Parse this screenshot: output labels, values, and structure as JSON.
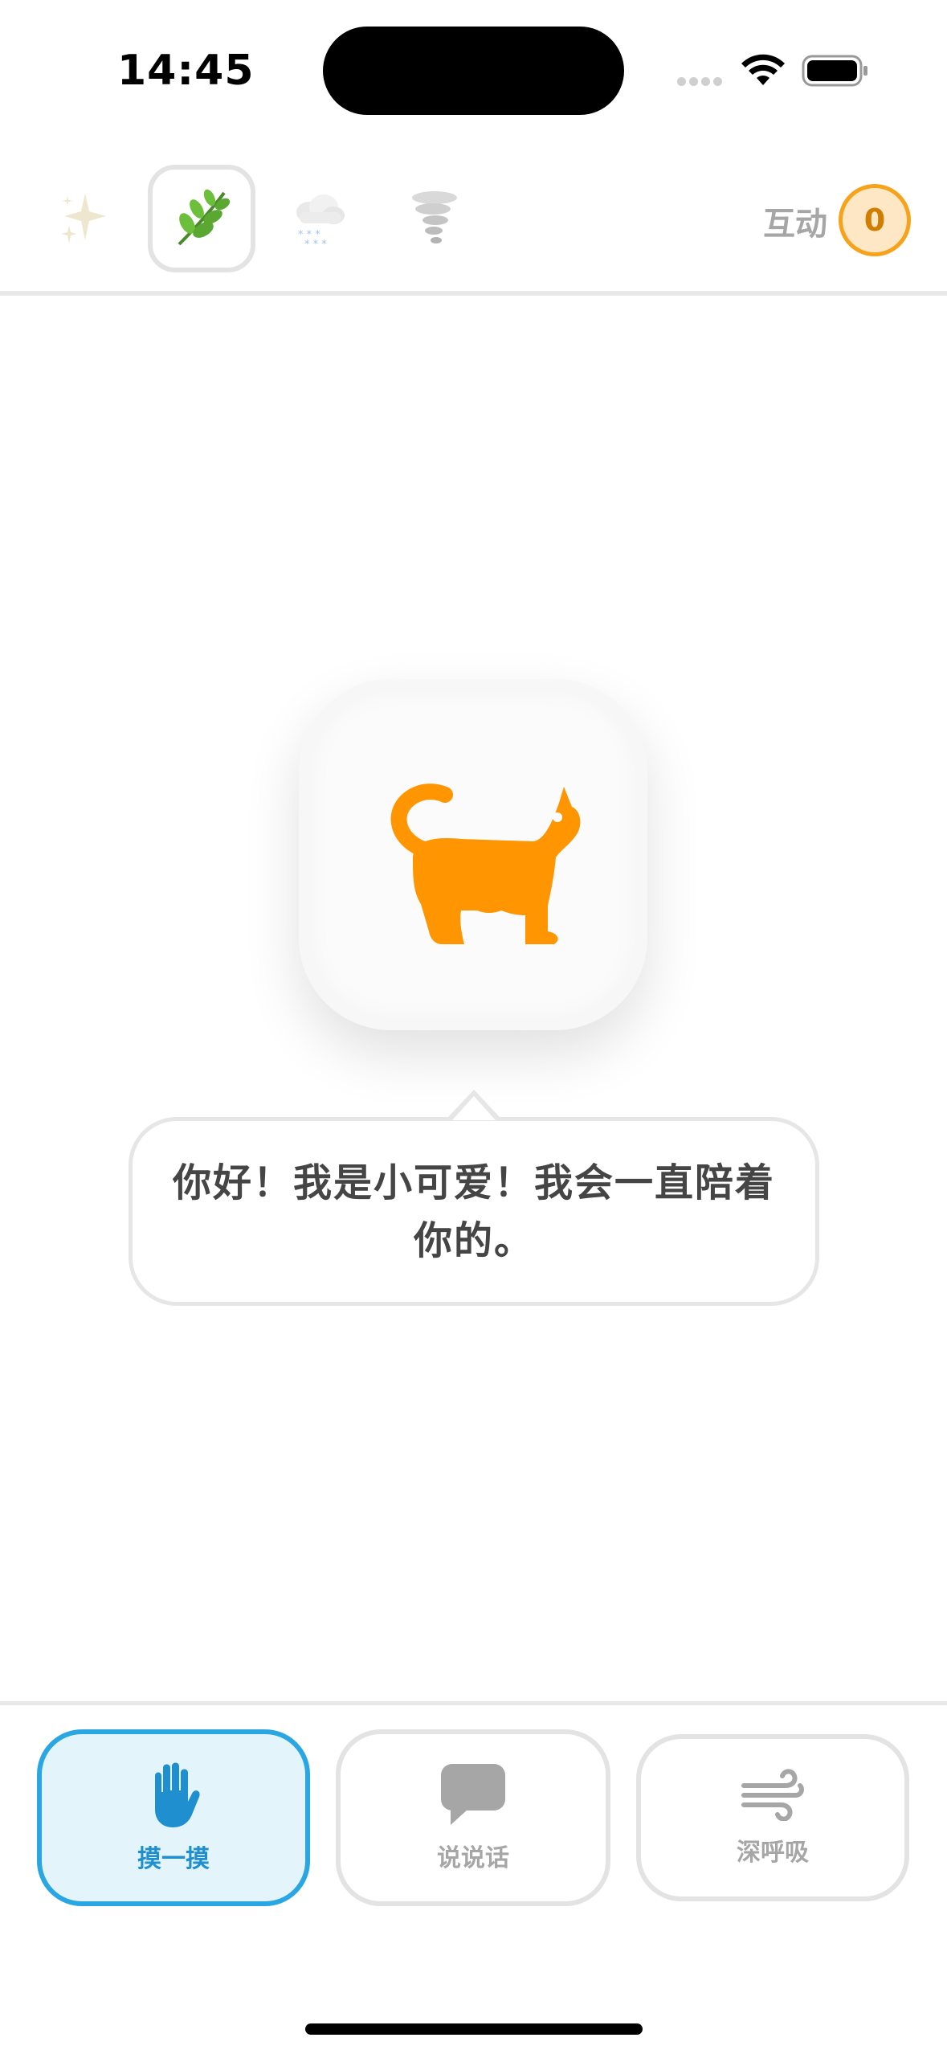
{
  "status_bar": {
    "time": "14:45"
  },
  "weather_tabs": [
    {
      "name": "sparkles",
      "emoji": "✨",
      "selected": false
    },
    {
      "name": "herb",
      "emoji": "🌿",
      "selected": true
    },
    {
      "name": "snow-cloud",
      "emoji": "🌨️",
      "selected": false
    },
    {
      "name": "tornado",
      "emoji": "🌪️",
      "selected": false
    }
  ],
  "interaction": {
    "label": "互动",
    "count": "0"
  },
  "pet": {
    "icon": "cat-icon",
    "color": "#ff9500"
  },
  "speech": {
    "line1": "你好！我是小可爱！我会一直陪着",
    "line2": "你的。"
  },
  "actions": [
    {
      "label": "摸一摸",
      "icon": "hand-icon",
      "active": true
    },
    {
      "label": "说说话",
      "icon": "chat-bubble-icon",
      "active": false
    },
    {
      "label": "深呼吸",
      "icon": "wind-icon",
      "active": false
    }
  ]
}
